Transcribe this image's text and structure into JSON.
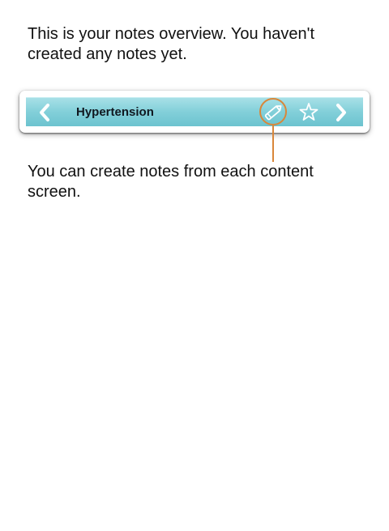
{
  "intro_text": "This is your notes overview. You haven't created any notes yet.",
  "toolbar": {
    "title": "Hypertension",
    "back_icon": "chevron-left-icon",
    "edit_icon": "pencil-icon",
    "favorite_icon": "star-icon",
    "forward_icon": "chevron-right-icon"
  },
  "hint_text": "You can create notes from each content screen.",
  "colors": {
    "toolbar_top": "#a7e0e7",
    "toolbar_bottom": "#6cc3cf",
    "highlight": "#d9873a",
    "icon": "#ffffff"
  }
}
